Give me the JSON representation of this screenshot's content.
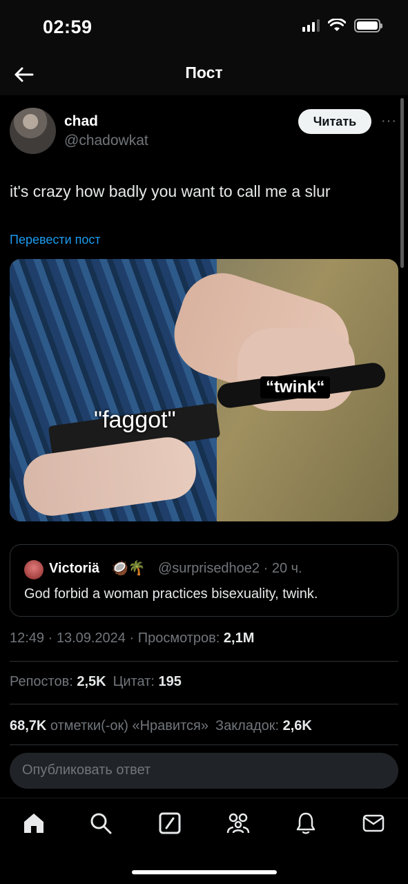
{
  "status_bar": {
    "time": "02:59"
  },
  "header": {
    "title": "Пост"
  },
  "post": {
    "author_name": "chad",
    "author_handle": "@chadowkat",
    "follow_label": "Читать",
    "more_label": "···",
    "text": "it's crazy how badly you want to call me a slur",
    "translate_label": "Перевести пост",
    "media_labels": {
      "left": "\"faggot\"",
      "right": "“twink“"
    }
  },
  "quote": {
    "name": "Victoriä",
    "emoji": "🥥🌴",
    "handle_time": "@surprisedhoe2 · 20 ч.",
    "text": "God forbid a woman practices bisexuality, twink."
  },
  "meta": {
    "datetime": "12:49 · 13.09.2024 · ",
    "views_label": "Просмотров: ",
    "views_value": "2,1M"
  },
  "stats": {
    "reposts_label": "Репостов: ",
    "reposts_value": "2,5K",
    "quotes_label": "Цитат: ",
    "quotes_value": "195",
    "likes_value": "68,7K",
    "likes_label": " отметки(-ок) «Нравится»",
    "bookmarks_label": "Закладок: ",
    "bookmarks_value": "2,6K"
  },
  "reply": {
    "placeholder": "Опубликовать ответ"
  },
  "nav": {
    "icons": [
      "home-icon",
      "search-icon",
      "grok-icon",
      "communities-icon",
      "notifications-icon",
      "messages-icon"
    ]
  },
  "colors": {
    "link": "#1d9bf0",
    "muted": "#71767b",
    "background": "#000000"
  }
}
